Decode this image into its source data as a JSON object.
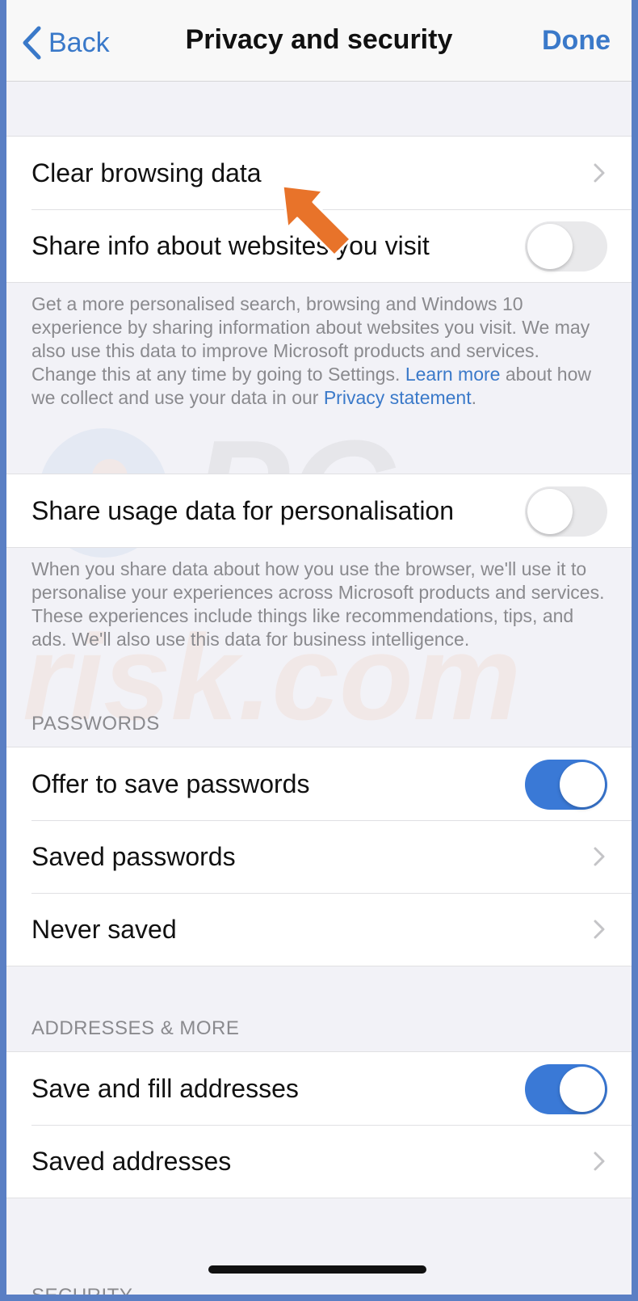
{
  "nav": {
    "back_label": "Back",
    "title": "Privacy and security",
    "done_label": "Done"
  },
  "group1": {
    "clear_browsing": "Clear browsing data",
    "share_info": "Share info about websites you visit",
    "share_info_on": false
  },
  "footnote1": {
    "text": "Get a more personalised search, browsing and Windows 10 experience by sharing information about websites you visit. We may also use this data to improve Microsoft products and services. Change this at any time by going to Settings.",
    "learn_more": "Learn more",
    "middle": "about how we collect and use your data in our",
    "privacy_statement": "Privacy statement",
    "end": "."
  },
  "group2": {
    "share_usage": "Share usage data for personalisation",
    "share_usage_on": false
  },
  "footnote2": {
    "text": "When you share data about how you use the browser, we'll use it to personalise your experiences across Microsoft products and services. These experiences include things like recommendations, tips, and ads. We'll also use this data for business intelligence."
  },
  "passwords": {
    "header": "PASSWORDS",
    "offer_save": "Offer to save passwords",
    "offer_save_on": true,
    "saved_passwords": "Saved passwords",
    "never_saved": "Never saved"
  },
  "addresses": {
    "header": "ADDRESSES & MORE",
    "save_fill": "Save and fill addresses",
    "save_fill_on": true,
    "saved_addresses": "Saved addresses"
  },
  "security": {
    "header": "SECURITY"
  },
  "watermark": {
    "text": "PCrisk.com"
  },
  "colors": {
    "accent": "#3a79c9",
    "toggle_on": "#3a79d6",
    "arrow": "#e8732a"
  }
}
